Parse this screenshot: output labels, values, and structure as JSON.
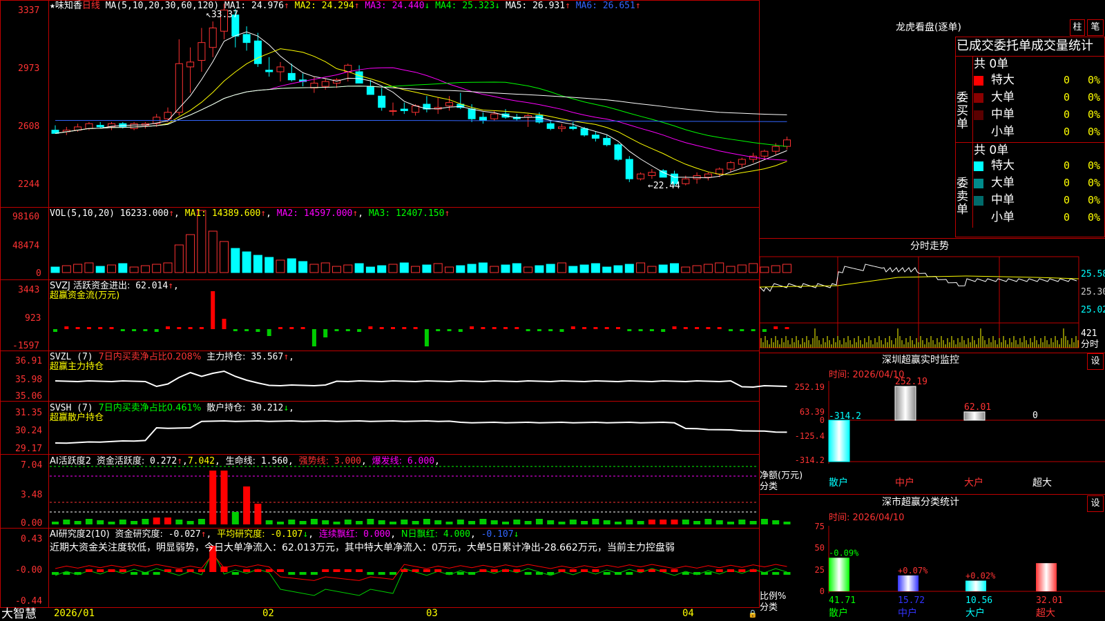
{
  "stock": {
    "star": "★",
    "name": "味知香",
    "period": "日线",
    "ma_label": "MA(5,10,20,30,60,120)",
    "ma": [
      {
        "label": "MA1:",
        "value": "24.976",
        "arrow": "↑",
        "color": "#fff"
      },
      {
        "label": "MA2:",
        "value": "24.294",
        "arrow": "↑",
        "color": "#ff0"
      },
      {
        "label": "MA3:",
        "value": "24.440",
        "arrow": "↓",
        "color": "#f0f"
      },
      {
        "label": "MA4:",
        "value": "25.323",
        "arrow": "↓",
        "color": "#0f0"
      },
      {
        "label": "MA5:",
        "value": "26.931",
        "arrow": "↑",
        "color": "#fff"
      },
      {
        "label": "MA6:",
        "value": "26.651",
        "arrow": "↑",
        "color": "#36f"
      }
    ],
    "high_marker": "33.37",
    "low_marker": "←22.44",
    "axis": [
      "3337",
      "2973",
      "2608",
      "2244"
    ]
  },
  "colors": {
    "up": "#ff3232",
    "down": "#00ffff",
    "frame": "#c00000",
    "ma1": "#ffffff",
    "ma2": "#ffff00",
    "ma3": "#ff00ff",
    "ma4": "#00ff00",
    "ma5": "#ffffff",
    "ma6": "#3366ff"
  },
  "candles": [
    [
      25.9,
      26.2,
      25.7,
      25.7
    ],
    [
      25.8,
      26.1,
      25.6,
      25.9
    ],
    [
      25.9,
      26.3,
      25.8,
      26.1
    ],
    [
      26.0,
      26.4,
      25.9,
      26.3
    ],
    [
      26.2,
      26.4,
      26.0,
      26.1
    ],
    [
      26.1,
      26.4,
      25.9,
      26.3
    ],
    [
      26.3,
      26.4,
      26.0,
      26.1
    ],
    [
      26.0,
      26.4,
      25.9,
      26.3
    ],
    [
      26.2,
      26.4,
      26.0,
      26.3
    ],
    [
      26.3,
      26.9,
      26.1,
      26.7
    ],
    [
      26.6,
      27.3,
      26.4,
      27.0
    ],
    [
      27.0,
      31.5,
      26.8,
      30.0
    ],
    [
      29.8,
      31.0,
      28.2,
      30.1
    ],
    [
      30.2,
      32.2,
      29.5,
      31.3
    ],
    [
      31.0,
      32.6,
      30.4,
      32.2
    ],
    [
      32.0,
      33.7,
      31.5,
      33.3
    ],
    [
      33.0,
      33.37,
      31.0,
      31.7
    ],
    [
      31.8,
      32.3,
      30.8,
      31.3
    ],
    [
      31.4,
      31.9,
      29.8,
      30.0
    ],
    [
      29.6,
      30.4,
      29.2,
      29.5
    ],
    [
      29.5,
      30.1,
      28.9,
      29.8
    ],
    [
      29.4,
      30.0,
      28.9,
      29.0
    ],
    [
      29.0,
      29.4,
      28.6,
      28.9
    ],
    [
      28.5,
      29.2,
      28.2,
      28.8
    ],
    [
      28.6,
      29.1,
      28.4,
      28.9
    ],
    [
      28.8,
      29.1,
      28.5,
      29.0
    ],
    [
      29.5,
      30.0,
      28.9,
      29.9
    ],
    [
      29.5,
      29.9,
      28.8,
      28.8
    ],
    [
      28.6,
      29.0,
      28.2,
      28.1
    ],
    [
      28.0,
      28.5,
      27.1,
      27.3
    ],
    [
      27.1,
      27.6,
      26.8,
      27.1
    ],
    [
      27.2,
      27.6,
      26.9,
      27.1
    ],
    [
      27.0,
      27.5,
      26.8,
      27.4
    ],
    [
      27.5,
      28.0,
      27.0,
      27.2
    ],
    [
      27.2,
      27.9,
      26.9,
      27.3
    ],
    [
      27.4,
      28.0,
      27.1,
      27.6
    ],
    [
      27.5,
      28.2,
      27.2,
      27.3
    ],
    [
      27.2,
      27.5,
      26.4,
      26.6
    ],
    [
      26.7,
      27.0,
      26.3,
      26.5
    ],
    [
      26.6,
      27.1,
      26.5,
      26.9
    ],
    [
      26.9,
      27.2,
      26.6,
      26.7
    ],
    [
      26.7,
      26.9,
      26.5,
      26.6
    ],
    [
      26.7,
      26.9,
      26.1,
      26.8
    ],
    [
      26.8,
      27.0,
      26.3,
      26.4
    ],
    [
      26.3,
      26.5,
      25.9,
      26.0
    ],
    [
      26.0,
      26.3,
      25.8,
      26.1
    ],
    [
      26.1,
      26.4,
      25.9,
      26.0
    ],
    [
      26.0,
      26.1,
      25.5,
      25.6
    ],
    [
      25.6,
      25.8,
      25.2,
      25.4
    ],
    [
      25.4,
      25.6,
      24.9,
      25.0
    ],
    [
      25.0,
      25.1,
      24.0,
      24.1
    ],
    [
      24.1,
      24.3,
      22.7,
      22.9
    ],
    [
      22.9,
      23.3,
      22.8,
      23.2
    ],
    [
      23.1,
      23.5,
      22.9,
      23.3
    ],
    [
      23.4,
      23.5,
      23.0,
      23.0
    ],
    [
      23.2,
      23.4,
      22.44,
      22.6
    ],
    [
      22.6,
      23.1,
      22.5,
      22.9
    ],
    [
      22.9,
      23.3,
      22.6,
      23.1
    ],
    [
      23.0,
      23.3,
      22.8,
      23.2
    ],
    [
      23.2,
      23.6,
      23.0,
      23.5
    ],
    [
      23.5,
      24.0,
      23.3,
      23.9
    ],
    [
      23.8,
      24.2,
      23.6,
      24.1
    ],
    [
      24.1,
      24.5,
      23.9,
      24.3
    ],
    [
      24.3,
      24.7,
      24.1,
      24.6
    ],
    [
      24.6,
      25.1,
      24.4,
      24.9
    ],
    [
      24.9,
      25.5,
      24.7,
      25.3
    ]
  ],
  "vol": {
    "label": "VOL(5,10,20)",
    "value": "16233.000",
    "arrow": "↑",
    "ma": [
      {
        "label": "MA1:",
        "value": "14389.600",
        "arrow": "↑",
        "color": "#ff0"
      },
      {
        "label": "MA2:",
        "value": "14597.000",
        "arrow": "↑",
        "color": "#f0f"
      },
      {
        "label": "MA3:",
        "value": "12407.150",
        "arrow": "↑",
        "color": "#0f0"
      }
    ],
    "axis": [
      "98160",
      "48474",
      "0"
    ]
  },
  "svzj": {
    "label": "SVZJ  活跃资金进出:",
    "value": "62.014",
    "arrow": "↑",
    "sub": "超赢资金流(万元)",
    "axis": [
      "3443",
      "923",
      "-1597"
    ]
  },
  "svzl": {
    "label": "SVZL (7)",
    "sub1": "7日内买卖净占比0.208%",
    "label2": "主力持仓:",
    "value": "35.567",
    "arrow": "↑",
    "sub": "超赢主力持仓",
    "axis": [
      "36.91",
      "35.98",
      "35.06"
    ]
  },
  "svsh": {
    "label": "SVSH (7)",
    "sub1": "7日内买卖净占比0.461%",
    "label2": "散户持仓:",
    "value": "30.212",
    "arrow": "↓",
    "sub": "超赢散户持仓",
    "axis": [
      "31.35",
      "30.24",
      "29.17"
    ]
  },
  "ai_active": {
    "label": "AI活跃度2",
    "l1": "资金活跃度:",
    "v1": "0.272",
    "a1": "↑",
    "v2": "7.042",
    "l3": "生命线:",
    "v3": "1.560",
    "l4": "强势线:",
    "v4": "3.000",
    "l5": "爆发线:",
    "v5": "6.000",
    "axis": [
      "7.04",
      "3.48",
      "0.00"
    ]
  },
  "ai_research": {
    "label": "AI研究度2(10)",
    "l1": "资金研究度:",
    "v1": "-0.027",
    "a1": "↑",
    "l2": "平均研究度:",
    "v2": "-0.107",
    "a2": "↓",
    "l3": "连续飘红:",
    "v3": "0.000",
    "l4": "N日飘红:",
    "v4": "4.000",
    "v5": "-0.107",
    "a5": "↓",
    "comment": "近期大资金关注度较低，明显弱势，今日大单净流入：62.013万元，其中特大单净流入：0万元，大单5日累计净出-28.662万元，当前主力控盘弱",
    "axis": [
      "0.43",
      "-0.00",
      "-0.44"
    ]
  },
  "x_axis": {
    "brand": "大智慧",
    "labels": [
      "2026/01",
      "02",
      "03",
      "04"
    ]
  },
  "right": {
    "dragon": {
      "title": "龙虎看盘(逐单)",
      "tab1": "柱",
      "tab2": "笔",
      "header": "已成交委托单成交量统计",
      "buy": {
        "label": "委买单",
        "total": "共 0单",
        "rows": [
          {
            "name": "特大",
            "count": "0",
            "pct": "0%",
            "color": "#ff0000"
          },
          {
            "name": "大单",
            "count": "0",
            "pct": "0%",
            "color": "#8b0000"
          },
          {
            "name": "中单",
            "count": "0",
            "pct": "0%",
            "color": "#5a0000"
          },
          {
            "name": "小单",
            "count": "0",
            "pct": "0%",
            "color": "#000000"
          }
        ]
      },
      "sell": {
        "label": "委卖单",
        "total": "共 0单",
        "rows": [
          {
            "name": "特大",
            "count": "0",
            "pct": "0%",
            "color": "#00ffff"
          },
          {
            "name": "大单",
            "count": "0",
            "pct": "0%",
            "color": "#008b8b"
          },
          {
            "name": "中单",
            "count": "0",
            "pct": "0%",
            "color": "#006b6b"
          },
          {
            "name": "小单",
            "count": "0",
            "pct": "0%",
            "color": "#000000"
          }
        ]
      }
    },
    "intraday": {
      "title": "分时走势",
      "axis": [
        "25.58",
        "25.30",
        "25.02"
      ],
      "vol_value": "421",
      "vol_label": "分时"
    },
    "sz_monitor": {
      "title": "深圳超赢实时监控",
      "btn": "设",
      "time": "时间: 2026/04/10",
      "axis": [
        "252.19",
        "63.39",
        "0",
        "-125.4",
        "-314.2"
      ],
      "footer1": "净额(万元)",
      "footer2": "分类",
      "cats": [
        "散户",
        "中户",
        "大户",
        "超大"
      ],
      "values": [
        -314.2,
        252.19,
        62.01,
        0
      ],
      "labels": [
        "-314.2",
        "252.19",
        "62.01",
        "0"
      ]
    },
    "sz_class": {
      "title": "深市超赢分类统计",
      "btn": "设",
      "time": "时间: 2026/04/10",
      "axis": [
        "75",
        "50",
        "25",
        "0"
      ],
      "footer1": "比例%",
      "footer2": "分类",
      "cats": [
        "散户",
        "中户",
        "大户",
        "超大"
      ],
      "values": [
        41.71,
        15.72,
        10.56,
        32.01
      ],
      "changes": [
        "-0.09%",
        "+0.07%",
        "+0.02%",
        ""
      ],
      "colors": [
        "#0f0",
        "#33f",
        "#0ff",
        "#f33"
      ]
    }
  }
}
